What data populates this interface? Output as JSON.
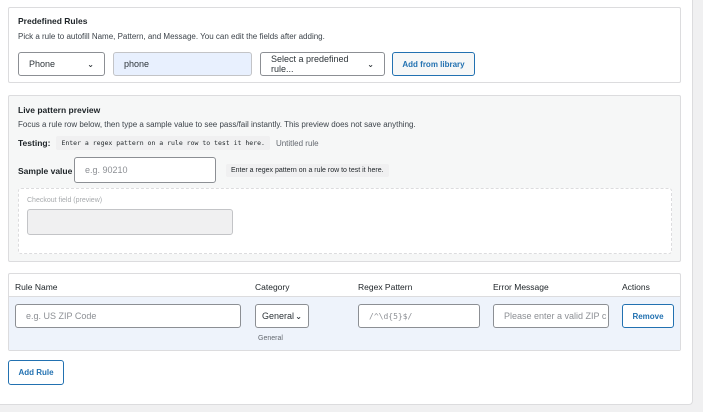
{
  "predefined": {
    "title": "Predefined Rules",
    "hint": "Pick a rule to autofill Name, Pattern, and Message. You can edit the fields after adding.",
    "category_select": "Phone",
    "category_value": "phone",
    "rule_select": "Select a predefined rule...",
    "add_library_label": "Add from library"
  },
  "preview": {
    "title": "Live pattern preview",
    "hint": "Focus a rule row below, then type a sample value to see pass/fail instantly. This preview does not save anything.",
    "testing_label": "Testing:",
    "testing_code": "Enter a regex pattern on a rule row to test it here.",
    "rule_name": "Untitled rule",
    "sample_label": "Sample value",
    "sample_placeholder": "e.g. 90210",
    "sample_status": "Enter a regex pattern on a rule row to test it here.",
    "checkout_label": "Checkout field (preview)"
  },
  "table": {
    "headers": [
      "Rule Name",
      "Category",
      "Regex Pattern",
      "Error Message",
      "Actions"
    ],
    "row": {
      "name_placeholder": "e.g. US ZIP Code",
      "category": "General",
      "category_caption": "General",
      "pattern_placeholder": "/^\\d{5}$/",
      "message_placeholder": "Please enter a valid ZIP c",
      "remove_label": "Remove"
    }
  },
  "add_rule_label": "Add Rule",
  "colors": {
    "accent": "#2271b1",
    "selected_input_bg": "#e8f0fe",
    "row_highlight": "#eef3fb"
  }
}
